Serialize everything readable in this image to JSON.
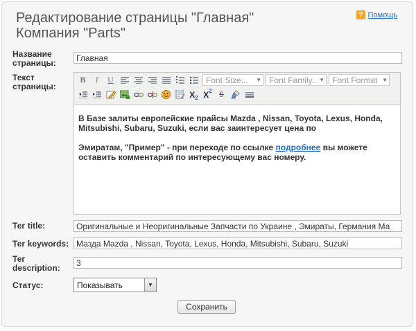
{
  "header": {
    "title_line1": "Редактирование страницы \"Главная\"",
    "title_line2": "Компания \"Parts\"",
    "help_label": "Помощь"
  },
  "form": {
    "page_name_label": "Название страницы:",
    "page_name_value": "Главная",
    "page_text_label": "Текст страницы:",
    "title_tag_label": "Тег title:",
    "title_tag_value": "Оригинальные и Неоригинальные Запчасти по Украине  , Эмираты, Германия  Ма",
    "keywords_label": "Тег keywords:",
    "keywords_value": "Мазда Mazda , Nissan, Toyota, Lexus, Honda, Mitsubishi, Subaru, Suzuki",
    "description_label": "Тег description:",
    "description_value": "3",
    "status_label": "Статус:",
    "status_value": "Показывать",
    "save_label": "Сохранить"
  },
  "editor": {
    "font_size_placeholder": "Font Size...",
    "font_family_placeholder": "Font Family..",
    "font_format_placeholder": "Font Format",
    "paragraph1": "В Базе залиты европейские прайсы Mazda , Nissan, Toyota, Lexus, Honda, Mitsubishi, Subaru, Suzuki, если вас заинтересует цена по",
    "paragraph2_before": "Эмиратам, \"Пример\" -  при переходе по ссылке ",
    "paragraph2_link": "подробнее",
    "paragraph2_after": " вы можете оставить комментарий по интересующему вас номеру.",
    "toolbar_row1": [
      "bold-icon",
      "italic-icon",
      "underline-icon",
      "align-left-icon",
      "align-center-icon",
      "align-right-icon",
      "align-justify-icon",
      "ordered-list-icon",
      "unordered-list-icon"
    ],
    "toolbar_row2": [
      "outdent-icon",
      "indent-icon",
      "edit-icon",
      "image-icon",
      "link-icon",
      "unlink-icon",
      "emoticon-icon",
      "code-icon",
      "subscript-icon",
      "superscript-icon",
      "strikethrough-icon",
      "clean-icon",
      "horizontal-rule-icon"
    ]
  },
  "colors": {
    "link": "#1a6cc8",
    "help_icon": "#f3a62b",
    "panel_bg": "#f6f6f6"
  }
}
